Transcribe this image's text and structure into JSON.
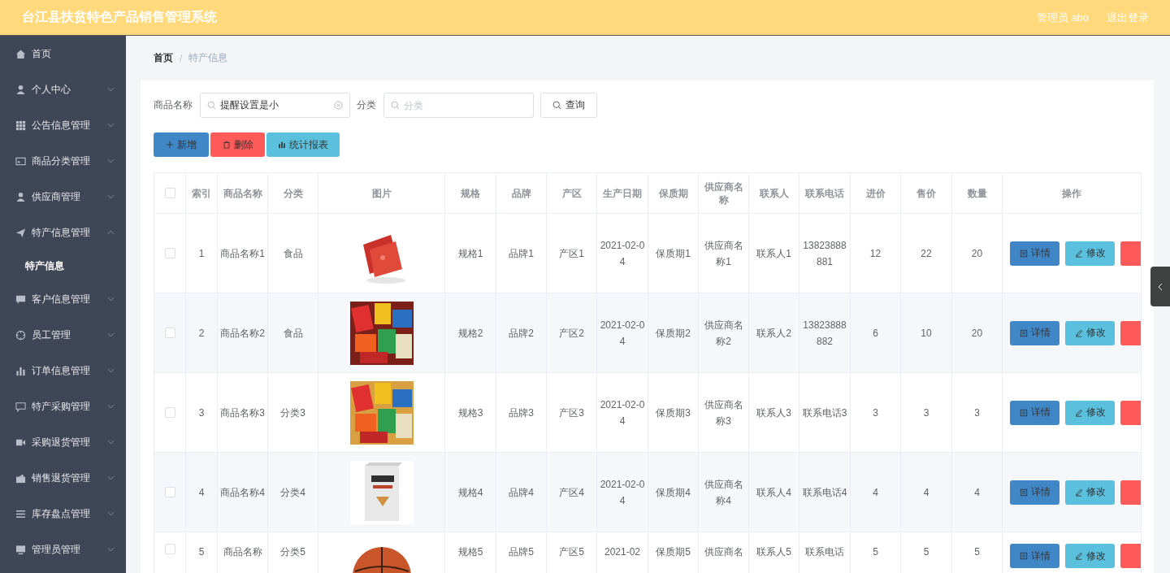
{
  "header": {
    "title": "台江县扶贫特色产品销售管理系统",
    "user": "管理员 abo",
    "logout": "退出登录"
  },
  "sidebar": {
    "items": [
      {
        "label": "首页"
      },
      {
        "label": "个人中心",
        "expanded": false
      },
      {
        "label": "公告信息管理",
        "expanded": false
      },
      {
        "label": "商品分类管理",
        "expanded": false
      },
      {
        "label": "供应商管理",
        "expanded": false
      },
      {
        "label": "特产信息管理",
        "expanded": true,
        "children": [
          {
            "label": "特产信息",
            "selected": true
          }
        ]
      },
      {
        "label": "客户信息管理",
        "expanded": false
      },
      {
        "label": "员工管理",
        "expanded": false
      },
      {
        "label": "订单信息管理",
        "expanded": false
      },
      {
        "label": "特产采购管理",
        "expanded": false
      },
      {
        "label": "采购退货管理",
        "expanded": false
      },
      {
        "label": "销售退货管理",
        "expanded": false
      },
      {
        "label": "库存盘点管理",
        "expanded": false
      },
      {
        "label": "管理员管理",
        "expanded": false
      }
    ]
  },
  "breadcrumb": {
    "items": [
      "首页",
      "特产信息"
    ],
    "separator": "/"
  },
  "search": {
    "name_label": "商品名称",
    "name_value": "提醒设置是小",
    "category_label": "分类",
    "category_placeholder": "分类",
    "query_button": "查询"
  },
  "toolbar": [
    {
      "label": "新增",
      "kind": "add"
    },
    {
      "label": "删除",
      "kind": "delete"
    },
    {
      "label": "统计报表",
      "kind": "report"
    }
  ],
  "table": {
    "header_checked": false,
    "columns": [
      "索引",
      "商品名称",
      "分类",
      "图片",
      "规格",
      "品牌",
      "产区",
      "生产日期",
      "保质期",
      "供应商名称",
      "联系人",
      "联系电话",
      "进价",
      "售价",
      "数量",
      "操作"
    ],
    "rows": [
      {
        "checked": false,
        "cells": [
          "1",
          "商品名称1",
          "食品",
          {
            "kind": "picture"
          },
          "规格1",
          "品牌1",
          "产区1",
          "2021-02-04",
          "保质期1",
          "供应商名称1",
          "联系人1",
          "13823888881",
          "12",
          "22",
          "20",
          {
            "kind": "actions",
            "buttons": [
              {
                "label": "详情",
                "kind": "detail"
              },
              {
                "label": "修改",
                "kind": "edit"
              },
              {
                "kind": "delete"
              }
            ]
          }
        ]
      },
      {
        "checked": false,
        "cells": [
          "2",
          "商品名称2",
          "食品",
          {
            "kind": "picture"
          },
          "规格2",
          "品牌2",
          "产区2",
          "2021-02-04",
          "保质期2",
          "供应商名称2",
          "联系人2",
          "13823888882",
          "6",
          "10",
          "20",
          {
            "kind": "actions",
            "buttons": [
              {
                "label": "详情",
                "kind": "detail"
              },
              {
                "label": "修改",
                "kind": "edit"
              },
              {
                "kind": "delete"
              }
            ]
          }
        ]
      },
      {
        "checked": false,
        "cells": [
          "3",
          "商品名称3",
          "分类3",
          {
            "kind": "picture"
          },
          "规格3",
          "品牌3",
          "产区3",
          "2021-02-04",
          "保质期3",
          "供应商名称3",
          "联系人3",
          "联系电话3",
          "3",
          "3",
          "3",
          {
            "kind": "actions",
            "buttons": [
              {
                "label": "详情",
                "kind": "detail"
              },
              {
                "label": "修改",
                "kind": "edit"
              },
              {
                "kind": "delete"
              }
            ]
          }
        ]
      },
      {
        "checked": false,
        "cells": [
          "4",
          "商品名称4",
          "分类4",
          {
            "kind": "picture"
          },
          "规格4",
          "品牌4",
          "产区4",
          "2021-02-04",
          "保质期4",
          "供应商名称4",
          "联系人4",
          "联系电话4",
          "4",
          "4",
          "4",
          {
            "kind": "actions",
            "buttons": [
              {
                "label": "详情",
                "kind": "detail"
              },
              {
                "label": "修改",
                "kind": "edit"
              },
              {
                "kind": "delete"
              }
            ]
          }
        ]
      },
      {
        "checked": false,
        "cells": [
          "5",
          "商品名称",
          "分类5",
          {
            "kind": "picture"
          },
          "规格5",
          "品牌5",
          "产区5",
          "2021-02",
          "保质期5",
          "供应商名",
          "联系人5",
          "联系电话",
          "5",
          "5",
          "5",
          {
            "kind": "actions",
            "buttons": [
              {
                "label": "详情",
                "kind": "detail"
              },
              {
                "label": "修改",
                "kind": "edit"
              },
              {
                "kind": "delete"
              }
            ]
          }
        ]
      }
    ]
  }
}
